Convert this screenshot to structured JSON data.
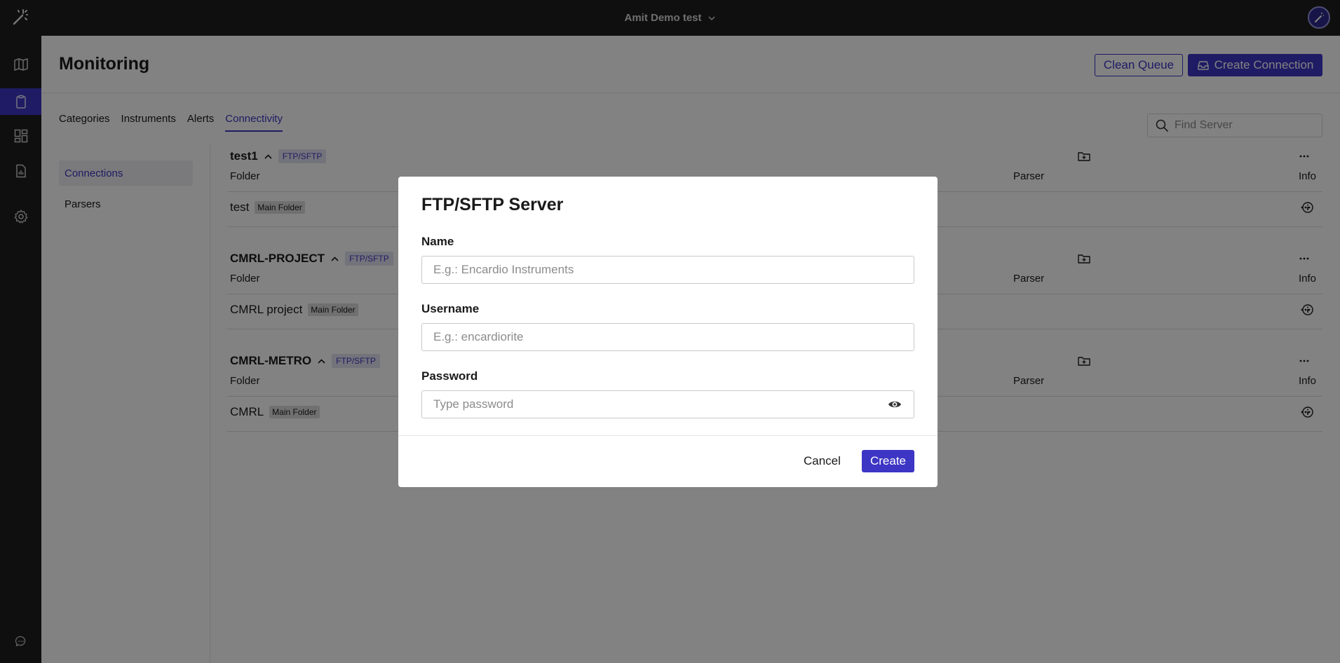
{
  "topbar": {
    "workspace": "Amit Demo test",
    "logo_icon": "wand-logo-icon",
    "avatar_icon": "user-avatar-icon"
  },
  "sidebar": {
    "items": [
      {
        "name": "map",
        "icon": "map-icon",
        "active": false
      },
      {
        "name": "clipboard",
        "icon": "clipboard-icon",
        "active": true
      },
      {
        "name": "dashboard",
        "icon": "dashboard-icon",
        "active": false
      },
      {
        "name": "reports",
        "icon": "report-icon",
        "active": false
      },
      {
        "name": "settings",
        "icon": "gear-icon",
        "active": false
      },
      {
        "name": "chat",
        "icon": "chat-icon",
        "active": false
      }
    ]
  },
  "page": {
    "title": "Monitoring",
    "clean_queue_label": "Clean Queue",
    "create_connection_label": "Create Connection"
  },
  "tabs": [
    {
      "label": "Categories",
      "active": false
    },
    {
      "label": "Instruments",
      "active": false
    },
    {
      "label": "Alerts",
      "active": false
    },
    {
      "label": "Connectivity",
      "active": true
    }
  ],
  "search": {
    "placeholder": "Find Server"
  },
  "subnav": [
    {
      "label": "Connections",
      "active": true
    },
    {
      "label": "Parsers",
      "active": false
    }
  ],
  "columns": {
    "folder": "Folder",
    "parser": "Parser",
    "info": "Info"
  },
  "groups": [
    {
      "name": "test1",
      "badge": "FTP/SFTP",
      "folder": "test",
      "tag": "Main Folder"
    },
    {
      "name": "CMRL-PROJECT",
      "badge": "FTP/SFTP",
      "folder": "CMRL project",
      "tag": "Main Folder"
    },
    {
      "name": "CMRL-METRO",
      "badge": "FTP/SFTP",
      "folder": "CMRL",
      "tag": "Main Folder"
    }
  ],
  "modal": {
    "title": "FTP/SFTP Server",
    "name_label": "Name",
    "name_placeholder": "E.g.: Encardio Instruments",
    "username_label": "Username",
    "username_placeholder": "E.g.: encardiorite",
    "password_label": "Password",
    "password_placeholder": "Type password",
    "cancel_label": "Cancel",
    "create_label": "Create"
  },
  "colors": {
    "accent": "#3d35c4",
    "topbar": "#1e1e1e",
    "badge_bg": "#e2e1f2"
  }
}
